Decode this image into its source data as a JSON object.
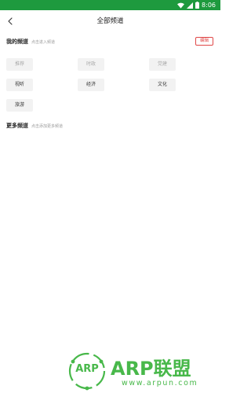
{
  "status_bar": {
    "time": "8:06",
    "color": "#1e9a3e",
    "icons": [
      "wifi-icon",
      "signal-icon",
      "battery-icon"
    ]
  },
  "header": {
    "title": "全部频道",
    "back_icon": "back-arrow-icon"
  },
  "my_channels": {
    "title": "我的频道",
    "hint": "点击进入频道",
    "edit_label": "编辑",
    "edit_color": "#e04848",
    "items": [
      {
        "label": "推荐",
        "fixed": true
      },
      {
        "label": "时政",
        "fixed": true
      },
      {
        "label": "党建",
        "fixed": true
      },
      {
        "label": "视听",
        "fixed": false
      },
      {
        "label": "经济",
        "fixed": false
      },
      {
        "label": "文化",
        "fixed": false
      },
      {
        "label": "旅游",
        "fixed": false
      }
    ]
  },
  "more_channels": {
    "title": "更多频道",
    "hint": "点击添加更多频道"
  },
  "watermark": {
    "badge": "ARP",
    "title": "ARP联盟",
    "url": "www.arpun.com",
    "color": "#48b84a"
  }
}
